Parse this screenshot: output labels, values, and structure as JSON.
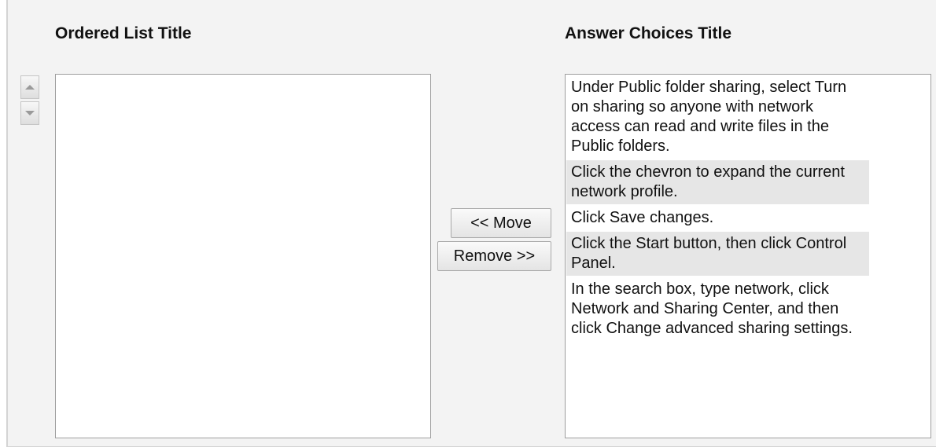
{
  "ordered_list": {
    "title": "Ordered List Title",
    "items": []
  },
  "answer_choices": {
    "title": "Answer Choices Title",
    "items": [
      "Under Public folder sharing, select Turn on sharing so anyone with network access can read and write files in the Public folders.",
      "Click the chevron to expand the current network profile.",
      "Click Save changes.",
      "Click the Start button, then click Control Panel.",
      "In the search box, type network, click Network and Sharing Center, and then click Change advanced sharing settings."
    ]
  },
  "buttons": {
    "move": "<< Move",
    "remove": "Remove >>"
  },
  "icons": {
    "up": "chevron-up-icon",
    "down": "chevron-down-icon"
  }
}
